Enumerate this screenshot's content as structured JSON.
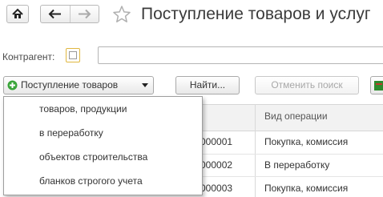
{
  "window": {
    "title": "Поступление товаров и услуг"
  },
  "filter": {
    "kontragent_label": "Контрагент:",
    "kontragent_value": ""
  },
  "toolbar": {
    "receipt_dropdown_label": "Поступление товаров",
    "find_button_label": "Найти...",
    "cancel_search_button_label": "Отменить поиск"
  },
  "table": {
    "header_operation": "Вид операции",
    "rows": [
      {
        "number_tail": "000001",
        "operation": "Покупка, комиссия"
      },
      {
        "number_tail": "000002",
        "operation": "В переработку"
      },
      {
        "number_tail": "000003",
        "operation": "Покупка, комиссия"
      }
    ]
  },
  "dropdown_menu": {
    "items": [
      "товаров, продукции",
      "в переработку",
      "объектов строительства",
      "бланков строгого учета"
    ]
  },
  "colors": {
    "accent_green": "#3aa53a",
    "checkbox_border": "#e0b740"
  },
  "icons": {
    "home": "home-icon",
    "back": "arrow-left-icon",
    "forward": "arrow-right-icon",
    "favorite": "star-icon",
    "add": "plus-circle-icon",
    "dropdown": "chevron-down-icon"
  }
}
